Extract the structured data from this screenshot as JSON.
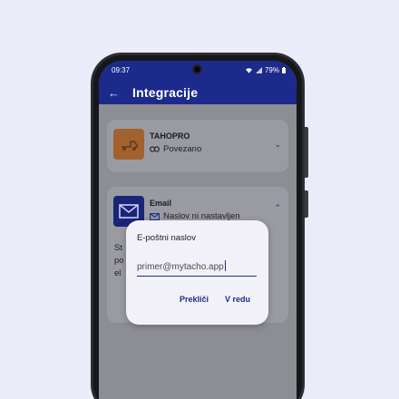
{
  "status": {
    "time": "09:37",
    "battery": "79%"
  },
  "appbar": {
    "title": "Integracije"
  },
  "cards": [
    {
      "title": "TAHOPRO",
      "subtitle": "Povezano"
    },
    {
      "title": "Email",
      "subtitle": "Naslov ni nastavljen",
      "body_fragments": [
        "St",
        "po",
        "el"
      ]
    }
  ],
  "dialog": {
    "title": "E-poštni naslov",
    "email_value": "primer@mytacho.app",
    "cancel_label": "Prekliči",
    "ok_label": "V redu"
  },
  "colors": {
    "primary": "#1c2a8c",
    "background": "#ecebfa",
    "dialog": "#f2f1f8"
  }
}
